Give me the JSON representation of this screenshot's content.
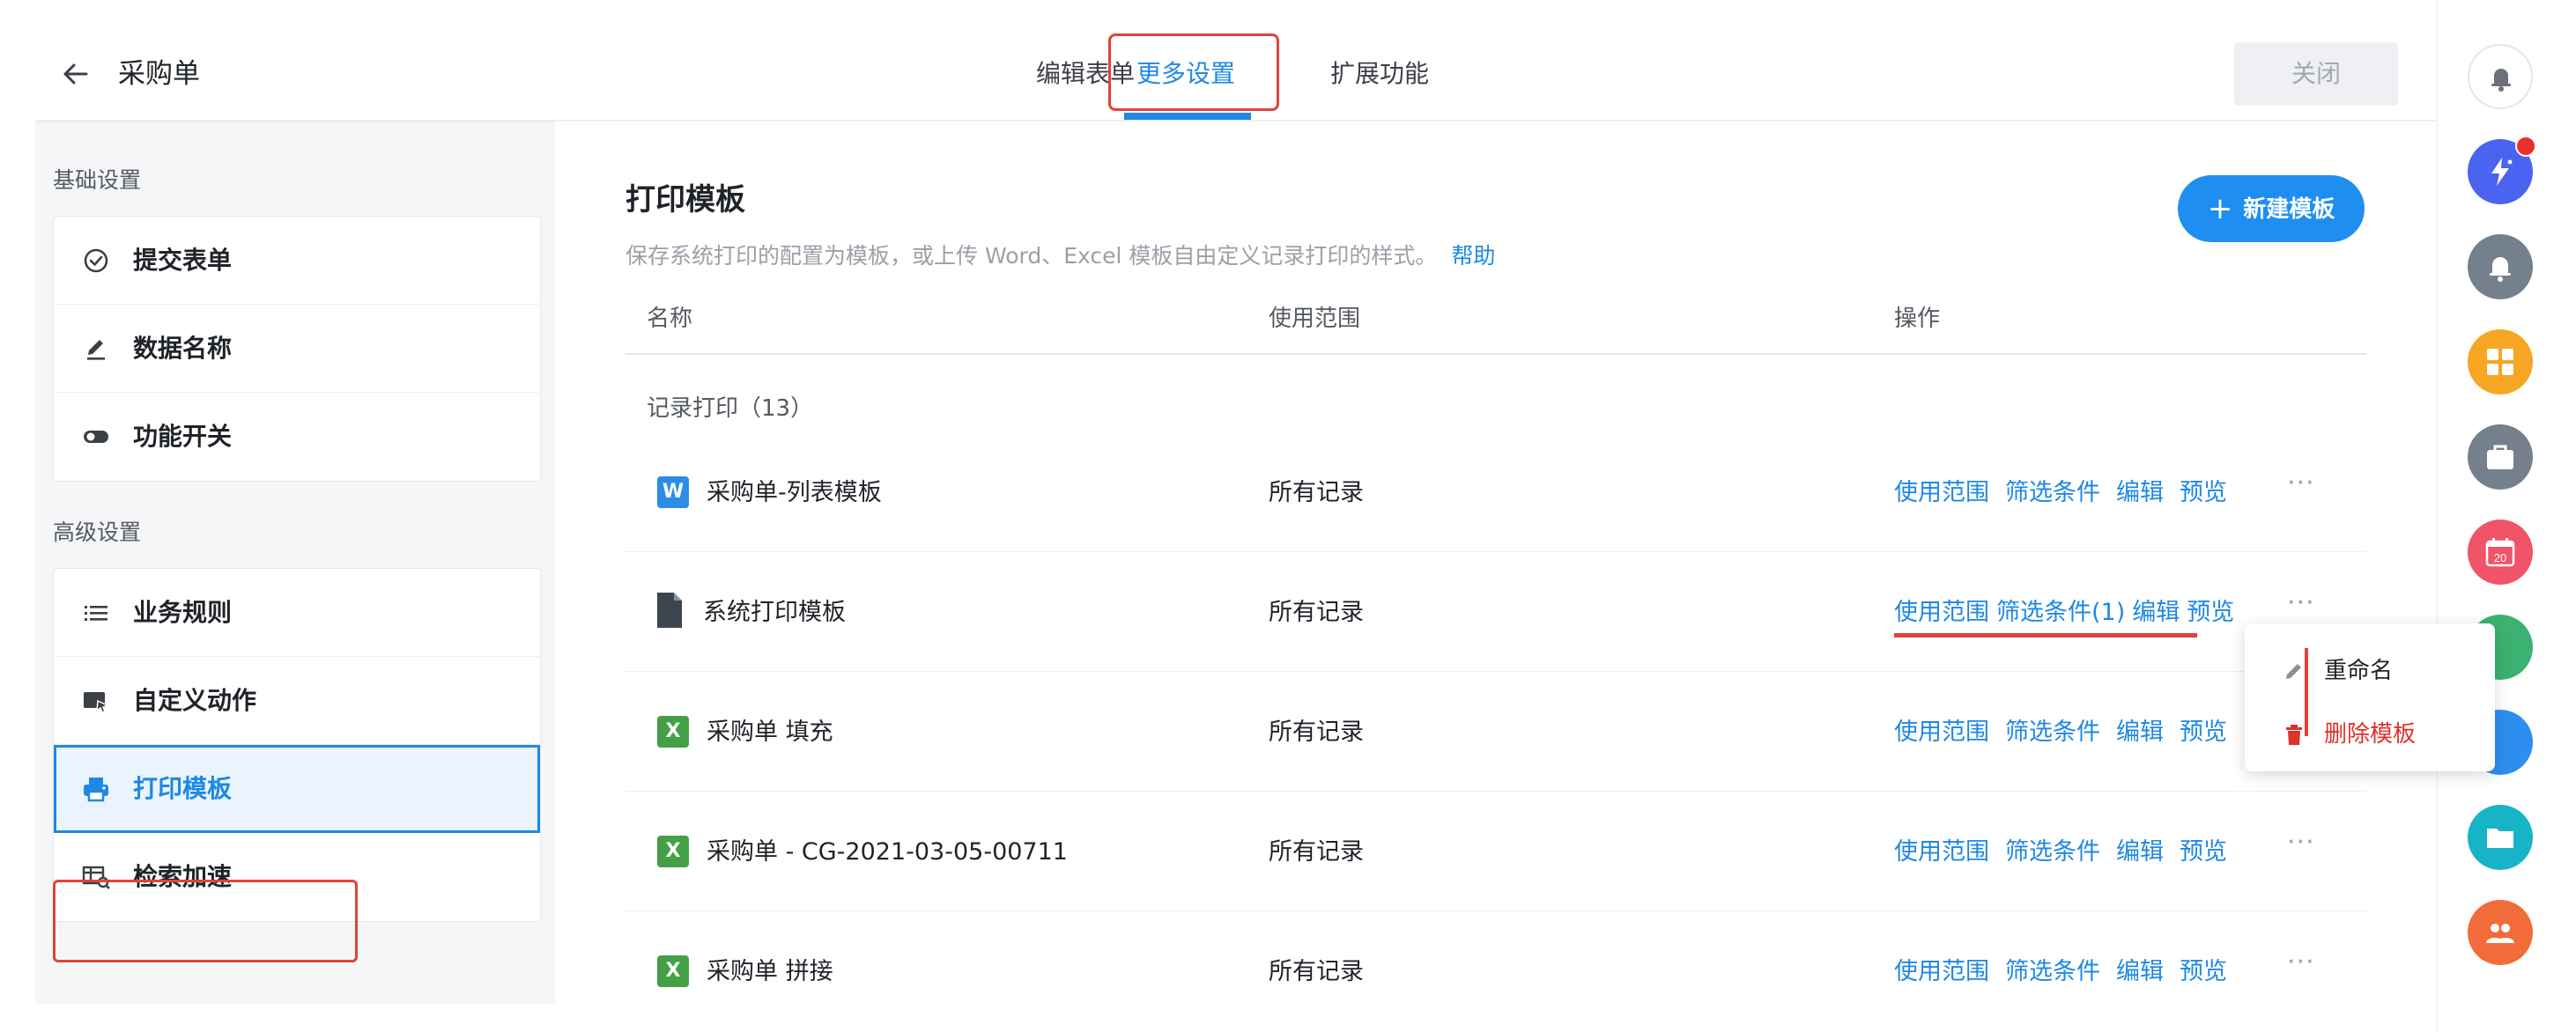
{
  "header": {
    "title": "采购单",
    "tabs": [
      {
        "label": "编辑表单"
      },
      {
        "label": "更多设置"
      },
      {
        "label": "扩展功能"
      }
    ],
    "active_tab": "更多设置",
    "close_label": "关闭"
  },
  "sidebar": {
    "basic_label": "基础设置",
    "basic_items": [
      {
        "label": "提交表单",
        "icon": "check-circle-icon"
      },
      {
        "label": "数据名称",
        "icon": "pencil-icon"
      },
      {
        "label": "功能开关",
        "icon": "toggle-icon"
      }
    ],
    "advanced_label": "高级设置",
    "advanced_items": [
      {
        "label": "业务规则",
        "icon": "list-icon"
      },
      {
        "label": "自定义动作",
        "icon": "cursor-window-icon"
      },
      {
        "label": "打印模板",
        "icon": "printer-icon"
      },
      {
        "label": "检索加速",
        "icon": "table-search-icon"
      }
    ],
    "active_item": "打印模板"
  },
  "content": {
    "title": "打印模板",
    "description": "保存系统打印的配置为模板，或上传 Word、Excel 模板自由定义记录打印的样式。",
    "help_link": "帮助",
    "new_button": "新建模板",
    "columns": {
      "name": "名称",
      "scope": "使用范围",
      "actions": "操作"
    },
    "group_label": "记录打印（13）",
    "rows": [
      {
        "type": "W",
        "name": "采购单-列表模板",
        "scope": "所有记录",
        "ops": [
          "使用范围",
          "筛选条件",
          "编辑",
          "预览"
        ]
      },
      {
        "type": "doc",
        "name": "系统打印模板",
        "scope": "所有记录",
        "ops": [
          "使用范围",
          "筛选条件(1)",
          "编辑",
          "预览"
        ]
      },
      {
        "type": "X",
        "name": "采购单 填充",
        "scope": "所有记录",
        "ops": [
          "使用范围",
          "筛选条件",
          "编辑",
          "预览"
        ]
      },
      {
        "type": "X",
        "name": "采购单 - CG-2021-03-05-00711",
        "scope": "所有记录",
        "ops": [
          "使用范围",
          "筛选条件",
          "编辑",
          "预览"
        ]
      },
      {
        "type": "X",
        "name": "采购单 拼接",
        "scope": "所有记录",
        "ops": [
          "使用范围",
          "筛选条件",
          "编辑",
          "预览"
        ]
      }
    ],
    "more_label": "···"
  },
  "dropdown": {
    "rename": "重命名",
    "delete": "删除模板"
  },
  "rightbar": {
    "calendar_day": "20"
  },
  "colors": {
    "accent": "#1e88e5",
    "danger": "#e0433a",
    "word": "#2b8de8",
    "excel": "#43a047"
  }
}
